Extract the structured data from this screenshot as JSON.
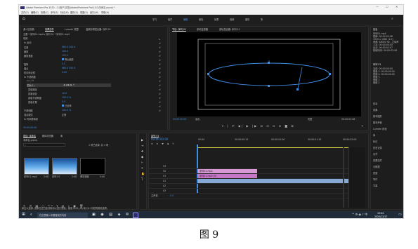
{
  "window": {
    "title": "Adobe Premiere Pro 2020 - C:\\用户\\文档\\Adobe\\Premiere Pro\\14.0\\未命名.prproj *",
    "controls": [
      "—",
      "☐",
      "✕"
    ]
  },
  "menu": [
    "文件(F)",
    "编辑(E)",
    "剪辑(C)",
    "序列(S)",
    "标记(M)",
    "图形(G)",
    "视图(V)",
    "窗口(W)",
    "帮助(H)"
  ],
  "workspaces": [
    "学习",
    "组件",
    "编辑",
    "颜色",
    "效果",
    "音频",
    "图形",
    "库"
  ],
  "effect_controls": {
    "tabs": [
      "源:(无剪辑)",
      "效果控件",
      "Lumetri 范围",
      "音频剪辑混合器: 序列 01"
    ],
    "breadcrumb": "主要 * 序列01.mp4 ▸ 序列 01 * 序列01.mp4",
    "section": "视频",
    "fx_motion": "fx 运动",
    "rows": [
      {
        "label": "位置",
        "value": "960.0   540.0"
      },
      {
        "label": "缩放",
        "value": "100.0"
      },
      {
        "label": "缩放宽度",
        "value": "100.0"
      },
      {
        "label": "",
        "value": "等比缩放"
      },
      {
        "label": "旋转",
        "value": "0.0"
      },
      {
        "label": "锚点",
        "value": "960.0   540.0"
      },
      {
        "label": "防闪烁滤镜",
        "value": "0.00"
      },
      {
        "label": "fx 不透明度",
        "value": ""
      },
      {
        "label": "蒙版(1)",
        "value": ""
      },
      {
        "label": "蒙版路径",
        "value": ""
      },
      {
        "label": "蒙版羽化",
        "value": "10.0"
      },
      {
        "label": "蒙版不透明度",
        "value": "100.0 %"
      },
      {
        "label": "蒙版扩展",
        "value": "0.0"
      },
      {
        "label": "",
        "value": "已反转"
      },
      {
        "label": "不透明度",
        "value": "100.0 %"
      },
      {
        "label": "混合模式",
        "value": "正常"
      },
      {
        "label": "fx 时间重映射",
        "value": ""
      }
    ],
    "timecode": "00:00:00:00"
  },
  "program": {
    "tabs": [
      "节目: 序列 01",
      "参考监视器",
      "音轨混合器: 序列 01"
    ],
    "timecode": "00:00:00:00",
    "fit": "适合",
    "quality": "完整",
    "duration": "00:00:02:08"
  },
  "right_panel": {
    "info_title": "信息",
    "info_lines": [
      "序列01.mp4",
      "视频: 00:00:02:08",
      "1920 x 1080 (1.0)",
      "音频: 48000 Hz - 立体声",
      "入点: 00:00:00:00",
      "出点: 00:00:02:07",
      "持续时间: 00:00:02:08"
    ],
    "seq_title": "序列 01",
    "seq_lines": [
      "当前: 00:00:00:00",
      "视频 1: 00:00:00:00",
      "视频 2: 00:00:00:00",
      "视频 3",
      "音频 1",
      "音频 2"
    ],
    "list": [
      "信息",
      "效果",
      "基本图形",
      "基本声音",
      "Lumetri 颜色",
      "库",
      "标记",
      "历史记录",
      "对齐",
      "效果控件",
      "元数据",
      "进度",
      "事件",
      "字幕"
    ]
  },
  "project": {
    "tabs": [
      "项目: 未命名",
      "媒体浏览器",
      "库"
    ],
    "name": "未命名.prproj",
    "search_placeholder": "",
    "count": "1 项已选择, 共 3 项",
    "items": [
      {
        "name": "序列01.mp4",
        "dur": "2:08"
      },
      {
        "name": "序列 01",
        "dur": "2:08"
      },
      {
        "name": "黑场视频",
        "dur": "5:00"
      }
    ]
  },
  "timeline": {
    "tab": "序列 01",
    "timecode": "00:00:00:00",
    "ruler": [
      "00:00",
      "00:00:00:15",
      "00:00:01:00",
      "00:00:01:15",
      "00:00:02:00"
    ],
    "tracks": [
      "V3",
      "V2",
      "V1",
      "A1",
      "A2",
      "A3",
      "主声道"
    ],
    "clip_top": "序列01.mp4",
    "clip_main": "序列01.mp4 [V]",
    "master_value": "0.0"
  },
  "status_bar": "单击以选择, 或单击空白处并拖动以进行框选。使用 Shift, Alt 和 Ctrl 可获得其他选项。",
  "taskbar": {
    "search": "在这里输入你要搜索的内容",
    "time": "15:44",
    "date": "2020/12/17"
  },
  "caption": "图 9"
}
